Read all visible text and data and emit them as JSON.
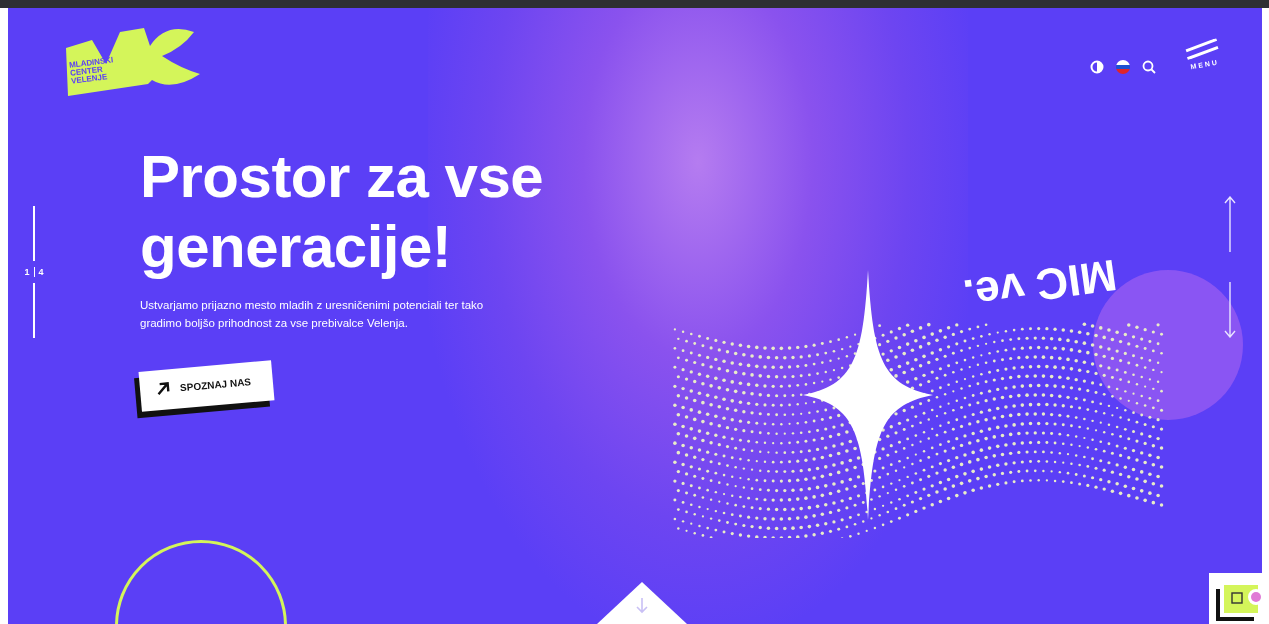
{
  "logo": {
    "lines": [
      "MLADINSKI",
      "CENTER",
      "VELENJE"
    ]
  },
  "header": {
    "menu_label": "MENU"
  },
  "hero": {
    "title_lines": [
      "Prostor za vse",
      "generacije!"
    ],
    "description": "Ustvarjamo prijazno mesto mladih z uresničenimi potenciali ter tako gradimo boljšo prihodnost za vse prebivalce Velenja.",
    "button": "SPOZNAJ NAS"
  },
  "slider": {
    "current": "1",
    "total": "4"
  },
  "tagline": "MIC ve."
}
